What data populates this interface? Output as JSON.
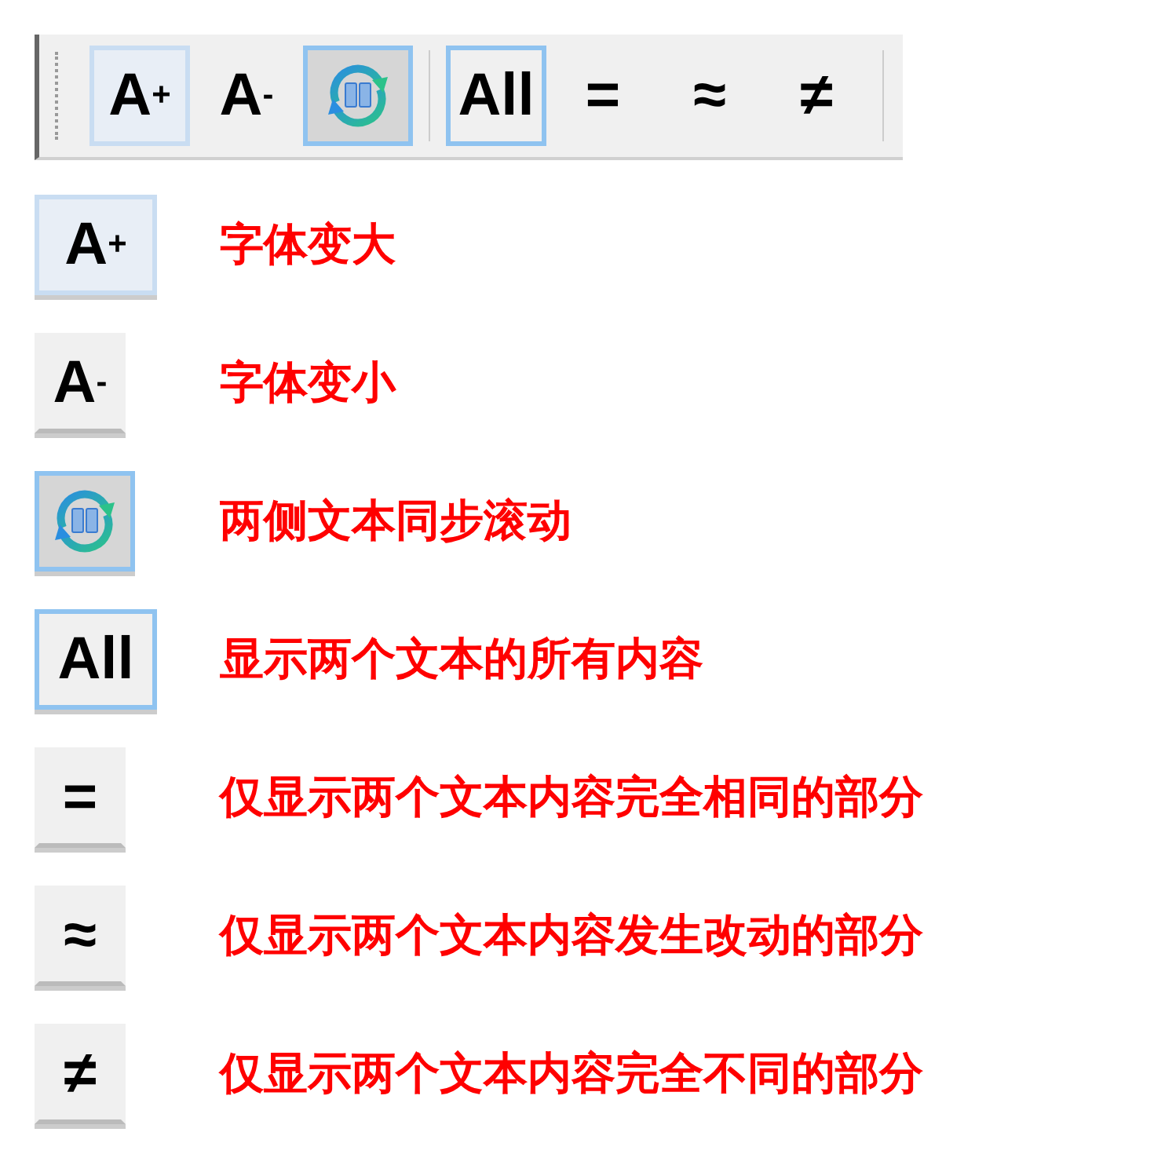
{
  "toolbar": {
    "groups": [
      [
        {
          "kind": "text",
          "label": "A$^{+}$",
          "hovered": true,
          "selected": false
        },
        {
          "kind": "text",
          "label": "A$^{-}$",
          "hovered": false,
          "selected": false
        },
        {
          "kind": "sync",
          "hovered": false,
          "selected": true
        }
      ],
      [
        {
          "kind": "text",
          "label": "All",
          "hovered": false,
          "selected": true
        },
        {
          "kind": "text",
          "label": "=",
          "hovered": false,
          "selected": false
        },
        {
          "kind": "text",
          "label": "≈",
          "hovered": false,
          "selected": false
        },
        {
          "kind": "text",
          "label": "≠",
          "hovered": false,
          "selected": false
        }
      ]
    ]
  },
  "legend": [
    {
      "kind": "text",
      "label": "A$^{+}$",
      "hovered": true,
      "selected": false,
      "description": "字体变大"
    },
    {
      "kind": "text",
      "label": "A$^{-}$",
      "hovered": false,
      "selected": false,
      "description": "字体变小"
    },
    {
      "kind": "sync",
      "hovered": false,
      "selected": true,
      "description": "两侧文本同步滚动"
    },
    {
      "kind": "text",
      "label": "All",
      "hovered": false,
      "selected": true,
      "description": "显示两个文本的所有内容"
    },
    {
      "kind": "text",
      "label": "=",
      "hovered": false,
      "selected": false,
      "description": "仅显示两个文本内容完全相同的部分"
    },
    {
      "kind": "text",
      "label": "≈",
      "hovered": false,
      "selected": false,
      "description": "仅显示两个文本内容发生改动的部分"
    },
    {
      "kind": "text",
      "label": "≠",
      "hovered": false,
      "selected": false,
      "description": "仅显示两个文本内容完全不同的部分"
    }
  ]
}
